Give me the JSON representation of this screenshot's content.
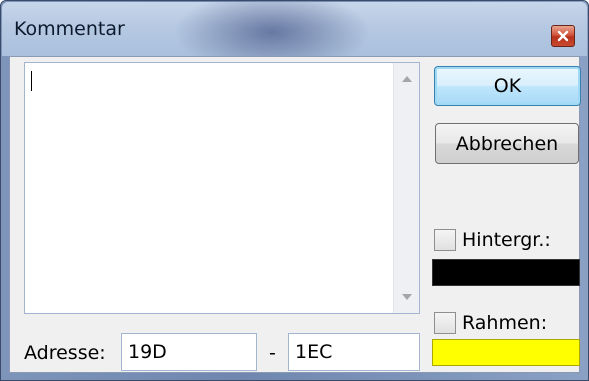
{
  "window": {
    "title": "Kommentar"
  },
  "comment": {
    "value": ""
  },
  "buttons": {
    "ok_label": "OK",
    "cancel_label": "Abbrechen"
  },
  "background_option": {
    "label": "Hintergr.:",
    "checked": false,
    "color": "#000000"
  },
  "frame_option": {
    "label": "Rahmen:",
    "checked": false,
    "color": "#ffff00"
  },
  "address": {
    "label": "Adresse:",
    "start": "19D",
    "separator": "-",
    "end": "1EC"
  },
  "icons": {
    "close": "close-icon",
    "scroll_up": "scroll-up-arrow-icon",
    "scroll_down": "scroll-down-arrow-icon"
  }
}
